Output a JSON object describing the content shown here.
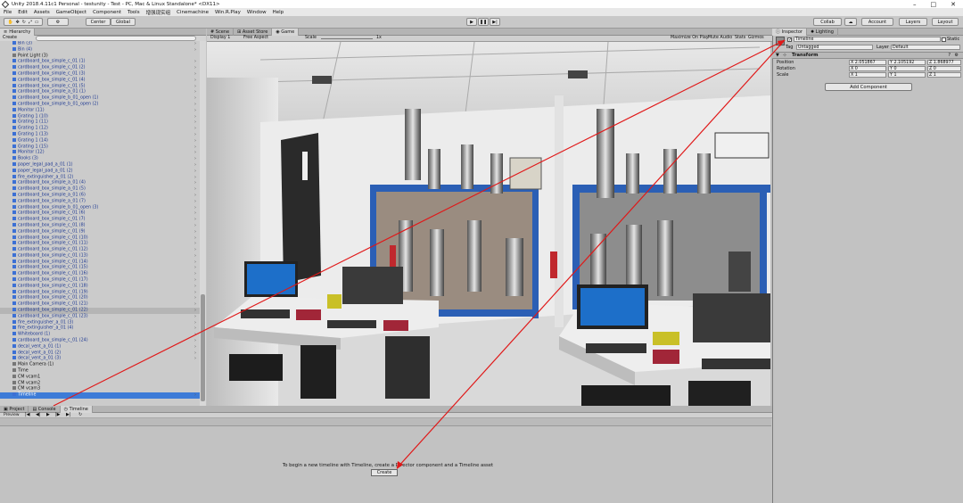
{
  "titlebar": {
    "title": "Unity 2018.4.11c1 Personal - testunity - Test - PC, Mac & Linux Standalone* <DX11>"
  },
  "menu": [
    "File",
    "Edit",
    "Assets",
    "GameObject",
    "Component",
    "Tools",
    "增强现实组",
    "Cinemachine",
    "Win.R.Play",
    "Window",
    "Help"
  ],
  "toolbar": {
    "center": "Center",
    "global": "Global",
    "collab": "Collab",
    "account": "Account",
    "layers": "Layers",
    "layout": "Layout"
  },
  "hierarchy": {
    "tab": "Hierarchy",
    "create": "Create",
    "items": [
      {
        "label": "Bin (3)"
      },
      {
        "label": "Bin (4)"
      },
      {
        "label": "Point Light (3)",
        "black": true
      },
      {
        "label": "cardboard_box_simple_c_01 (1)"
      },
      {
        "label": "cardboard_box_simple_c_01 (2)"
      },
      {
        "label": "cardboard_box_simple_c_01 (3)"
      },
      {
        "label": "cardboard_box_simple_c_01 (4)"
      },
      {
        "label": "cardboard_box_simple_c_01 (5)"
      },
      {
        "label": "cardboard_box_simple_a_01 (1)"
      },
      {
        "label": "cardboard_box_simple_b_01_open (1)"
      },
      {
        "label": "cardboard_box_simple_b_01_open (2)"
      },
      {
        "label": "Monitor (11)"
      },
      {
        "label": "Grating 1 (10)"
      },
      {
        "label": "Grating 1 (11)"
      },
      {
        "label": "Grating 1 (12)"
      },
      {
        "label": "Grating 1 (13)"
      },
      {
        "label": "Grating 1 (14)"
      },
      {
        "label": "Grating 1 (15)"
      },
      {
        "label": "Monitor (12)"
      },
      {
        "label": "Books (3)"
      },
      {
        "label": "paper_legal_pad_a_01 (1)"
      },
      {
        "label": "paper_legal_pad_a_01 (2)"
      },
      {
        "label": "fire_extinguisher_a_01 (2)"
      },
      {
        "label": "cardboard_box_simple_a_01 (4)"
      },
      {
        "label": "cardboard_box_simple_a_01 (5)"
      },
      {
        "label": "cardboard_box_simple_a_01 (6)"
      },
      {
        "label": "cardboard_box_simple_a_01 (7)"
      },
      {
        "label": "cardboard_box_simple_b_01_open (3)"
      },
      {
        "label": "cardboard_box_simple_c_01 (6)"
      },
      {
        "label": "cardboard_box_simple_c_01 (7)"
      },
      {
        "label": "cardboard_box_simple_c_01 (8)"
      },
      {
        "label": "cardboard_box_simple_c_01 (9)"
      },
      {
        "label": "cardboard_box_simple_c_01 (10)"
      },
      {
        "label": "cardboard_box_simple_c_01 (11)"
      },
      {
        "label": "cardboard_box_simple_c_01 (12)"
      },
      {
        "label": "cardboard_box_simple_c_01 (13)"
      },
      {
        "label": "cardboard_box_simple_c_01 (14)"
      },
      {
        "label": "cardboard_box_simple_c_01 (15)"
      },
      {
        "label": "cardboard_box_simple_c_01 (16)"
      },
      {
        "label": "cardboard_box_simple_c_01 (17)"
      },
      {
        "label": "cardboard_box_simple_c_01 (18)"
      },
      {
        "label": "cardboard_box_simple_c_01 (19)"
      },
      {
        "label": "cardboard_box_simple_c_01 (20)"
      },
      {
        "label": "cardboard_box_simple_c_01 (21)"
      },
      {
        "label": "cardboard_box_simple_c_01 (22)",
        "hl": true
      },
      {
        "label": "cardboard_box_simple_c_01 (23)"
      },
      {
        "label": "fire_extinguisher_a_01 (3)"
      },
      {
        "label": "fire_extinguisher_a_01 (4)"
      },
      {
        "label": "Whiteboard (1)"
      },
      {
        "label": "cardboard_box_simple_c_01 (24)"
      },
      {
        "label": "decal_vent_a_01 (1)"
      },
      {
        "label": "decal_vent_a_01 (2)"
      },
      {
        "label": "decal_vent_a_01 (3)"
      },
      {
        "label": "Main Camera (1)",
        "black": true
      },
      {
        "label": "Time",
        "black": true
      },
      {
        "label": "CM vcam1",
        "black": true
      },
      {
        "label": "CM vcam2",
        "black": true
      },
      {
        "label": "CM vcam3",
        "black": true
      },
      {
        "label": "Timeline",
        "sel": true
      }
    ]
  },
  "scene_tabs": [
    "Scene",
    "Asset Store",
    "Game"
  ],
  "game": {
    "display": "Display 1",
    "aspect": "Free Aspect",
    "scale_label": "Scale",
    "scale_value": "1x",
    "maximize": "Maximize On Play",
    "mute": "Mute Audio",
    "stats": "Stats",
    "gizmos": "Gizmos"
  },
  "bottom_tabs": [
    "Project",
    "Console",
    "Timeline"
  ],
  "timeline": {
    "preview": "Preview",
    "message": "To begin a new timeline with Timeline, create a Director component and a Timeline asset",
    "create": "Create"
  },
  "inspector": {
    "tabs": [
      "Inspector",
      "Lighting"
    ],
    "name": "Timeline",
    "static": "Static",
    "tag_label": "Tag",
    "tag": "Untagged",
    "layer_label": "Layer",
    "layer": "Default",
    "component": "Transform",
    "position_label": "Position",
    "rotation_label": "Rotation",
    "scale_label": "Scale",
    "position": [
      "X 2.051867",
      "Y 2.105192",
      "Z 1.868977"
    ],
    "rotation": [
      "X 0",
      "Y 0",
      "Z 0"
    ],
    "scale": [
      "X 1",
      "Y 1",
      "Z 1"
    ],
    "add_component": "Add Component"
  },
  "colors": {
    "arrow": "#e01818",
    "selection": "#3d7bd7",
    "rack": "#2b5fb5"
  }
}
